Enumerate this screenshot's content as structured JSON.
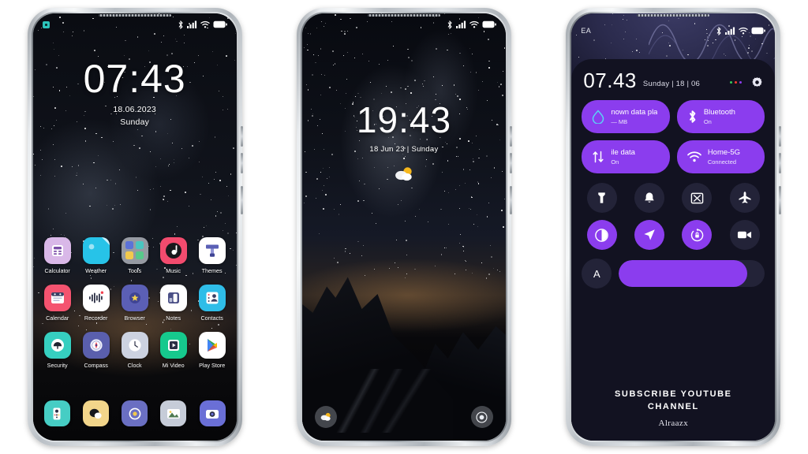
{
  "phone1": {
    "name": "homescreen",
    "statusbar": {
      "notification_icon": "app-notification-badge-icon",
      "bluetooth_icon": "bluetooth-icon",
      "signal_icon": "cellular-signal-icon",
      "wifi_icon": "wifi-icon",
      "battery_icon": "battery-full-icon"
    },
    "clock": {
      "time": "07:43",
      "date": "18.06.2023",
      "day": "Sunday"
    },
    "apps": [
      [
        {
          "label": "Calculator",
          "icon": "calculator-icon",
          "bg": "#d9b8e8"
        },
        {
          "label": "Weather",
          "icon": "weather-icon",
          "bg": "#27c3e8"
        },
        {
          "label": "Tools",
          "icon": "tools-folder-icon",
          "bg": "#b9bcc4"
        },
        {
          "label": "Music",
          "icon": "music-icon",
          "bg": "#f24b6e"
        },
        {
          "label": "Themes",
          "icon": "themes-icon",
          "bg": "#ffffff"
        }
      ],
      [
        {
          "label": "Calendar",
          "icon": "calendar-icon",
          "bg": "#f4536f"
        },
        {
          "label": "Recorder",
          "icon": "recorder-icon",
          "bg": "#ffffff"
        },
        {
          "label": "Browser",
          "icon": "browser-icon",
          "bg": "#5b5fb5"
        },
        {
          "label": "Notes",
          "icon": "notes-icon",
          "bg": "#ffffff"
        },
        {
          "label": "Contacts",
          "icon": "contacts-icon",
          "bg": "#2fbde8"
        }
      ],
      [
        {
          "label": "Security",
          "icon": "security-icon",
          "bg": "#36cfc0"
        },
        {
          "label": "Compass",
          "icon": "compass-icon",
          "bg": "#5a5fad"
        },
        {
          "label": "Clock",
          "icon": "clock-icon",
          "bg": "#ccd2e0"
        },
        {
          "label": "Mi Video",
          "icon": "mi-video-icon",
          "bg": "#16c98d"
        },
        {
          "label": "Play Store",
          "icon": "play-store-icon",
          "bg": "#ffffff"
        }
      ]
    ],
    "dock": [
      {
        "label": "Phone",
        "icon": "phone-dialer-icon",
        "bg": "#46cdc4"
      },
      {
        "label": "Messages",
        "icon": "messages-icon",
        "bg": "#f2d58a"
      },
      {
        "label": "Settings",
        "icon": "settings-icon",
        "bg": "#6a6fc2"
      },
      {
        "label": "Gallery",
        "icon": "gallery-icon",
        "bg": "#c6ccd8"
      },
      {
        "label": "Camera",
        "icon": "camera-icon",
        "bg": "#6a6fd6"
      }
    ]
  },
  "phone2": {
    "name": "lockscreen",
    "statusbar": {
      "bluetooth_icon": "bluetooth-icon",
      "signal_icon": "cellular-signal-icon",
      "wifi_icon": "wifi-icon",
      "battery_icon": "battery-full-icon"
    },
    "clock": {
      "time": "19:43",
      "sub": "18 Jun 23 | Sunday",
      "weather_icon": "partly-cloudy-icon"
    },
    "shortcuts": [
      {
        "name": "weather-shortcut",
        "icon": "partly-cloudy-icon"
      },
      {
        "name": "camera-shortcut",
        "icon": "camera-icon"
      }
    ]
  },
  "phone3": {
    "name": "control-center",
    "statusbar": {
      "carrier": "EA",
      "bluetooth_icon": "bluetooth-icon",
      "signal_icon": "cellular-signal-icon",
      "wifi_icon": "wifi-icon",
      "battery_icon": "battery-full-icon"
    },
    "header": {
      "time": "07.43",
      "date": "Sunday | 18 | 06",
      "menu_icon": "more-dots-icon",
      "settings_icon": "gear-icon",
      "dot_colors": [
        "#35c759",
        "#ff3b30",
        "#8b3dee"
      ]
    },
    "tiles": [
      {
        "title": "nown data pla",
        "sub": "— MB",
        "icon": "data-usage-drop-icon",
        "active": true
      },
      {
        "title": "Bluetooth",
        "sub": "On",
        "icon": "bluetooth-icon",
        "active": true
      },
      {
        "title": "ile data",
        "sub": "On",
        "icon": "mobile-data-icon",
        "active": true
      },
      {
        "title": "Home-5G",
        "sub": "Connected",
        "icon": "wifi-icon",
        "active": true
      }
    ],
    "toggles": [
      {
        "name": "flashlight-toggle",
        "icon": "flashlight-icon",
        "active": false
      },
      {
        "name": "sound-toggle",
        "icon": "bell-icon",
        "active": false
      },
      {
        "name": "screenshot-toggle",
        "icon": "screenshot-icon",
        "active": false
      },
      {
        "name": "airplane-mode-toggle",
        "icon": "airplane-icon",
        "active": false
      },
      {
        "name": "dark-mode-toggle",
        "icon": "contrast-icon",
        "active": true
      },
      {
        "name": "location-toggle",
        "icon": "location-arrow-icon",
        "active": true
      },
      {
        "name": "auto-rotate-toggle",
        "icon": "rotate-lock-icon",
        "active": true
      },
      {
        "name": "screen-record-toggle",
        "icon": "video-camera-icon",
        "active": false
      }
    ],
    "brightness": {
      "auto_label": "A",
      "auto_icon": "auto-brightness-icon",
      "level_percent": 88
    },
    "footer": {
      "line1": "SUBSCRIBE YOUTUBE",
      "line2": "CHANNEL",
      "brand": "Alraazx"
    },
    "colors": {
      "accent": "#8b3dee",
      "panel": "#121221",
      "toggle_off": "#232338"
    }
  }
}
